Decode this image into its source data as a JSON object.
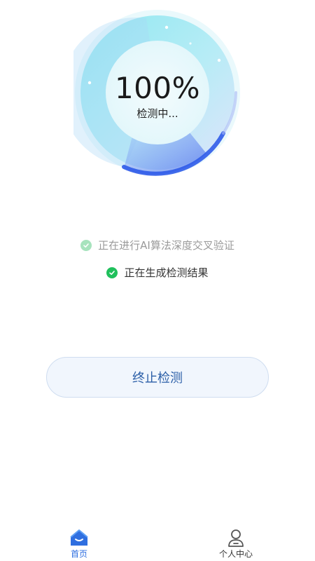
{
  "progress": {
    "percent_text": "100%",
    "value": 1.0,
    "status_text": "检测中..."
  },
  "steps": [
    {
      "label": "正在进行AI算法深度交叉验证",
      "state": "completed-faded"
    },
    {
      "label": "正在生成检测结果",
      "state": "completed"
    }
  ],
  "stop_button": {
    "label": "终止检测"
  },
  "tabbar": {
    "home_label": "首页",
    "profile_label": "个人中心",
    "active": "home"
  },
  "colors": {
    "accent_blue": "#2f6fe0",
    "check_green": "#20c05c",
    "check_green_faded": "#a7e3bd",
    "button_text": "#2c5fa8",
    "dial_cyan": "#9feaf2"
  },
  "icons": {
    "home": "home-icon",
    "profile": "user-icon",
    "check": "check-circle-icon"
  }
}
